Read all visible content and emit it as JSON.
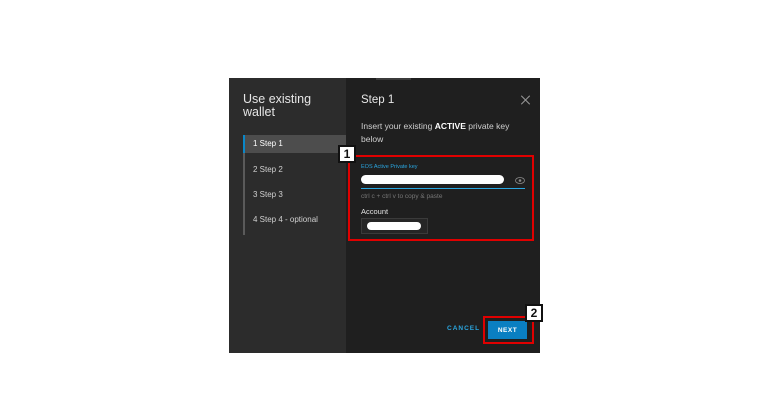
{
  "dialog": {
    "sidebar": {
      "title": "Use existing wallet",
      "steps": [
        {
          "label": "1  Step 1",
          "active": true
        },
        {
          "label": "2  Step 2",
          "active": false
        },
        {
          "label": "3  Step 3",
          "active": false
        },
        {
          "label": "4  Step 4 - optional",
          "active": false
        }
      ]
    },
    "main": {
      "title": "Step 1",
      "instructions_before": "Insert your existing ",
      "instructions_strong": "ACTIVE",
      "instructions_after": " private key below",
      "key_field_label": "EOS Active Private key",
      "hint": "ctrl c + ctrl v to copy & paste",
      "account_label": "Account"
    },
    "buttons": {
      "cancel": "CANCEL",
      "next": "NEXT"
    }
  },
  "annotations": {
    "callout_1": "1",
    "callout_2": "2",
    "highlight_color": "#e00000"
  },
  "colors": {
    "accent": "#0a87c8",
    "dialog_bg": "#1f1f1f",
    "sidebar_bg": "#2c2c2c"
  },
  "icons": {
    "close": "close-icon",
    "reveal": "eye-icon"
  }
}
